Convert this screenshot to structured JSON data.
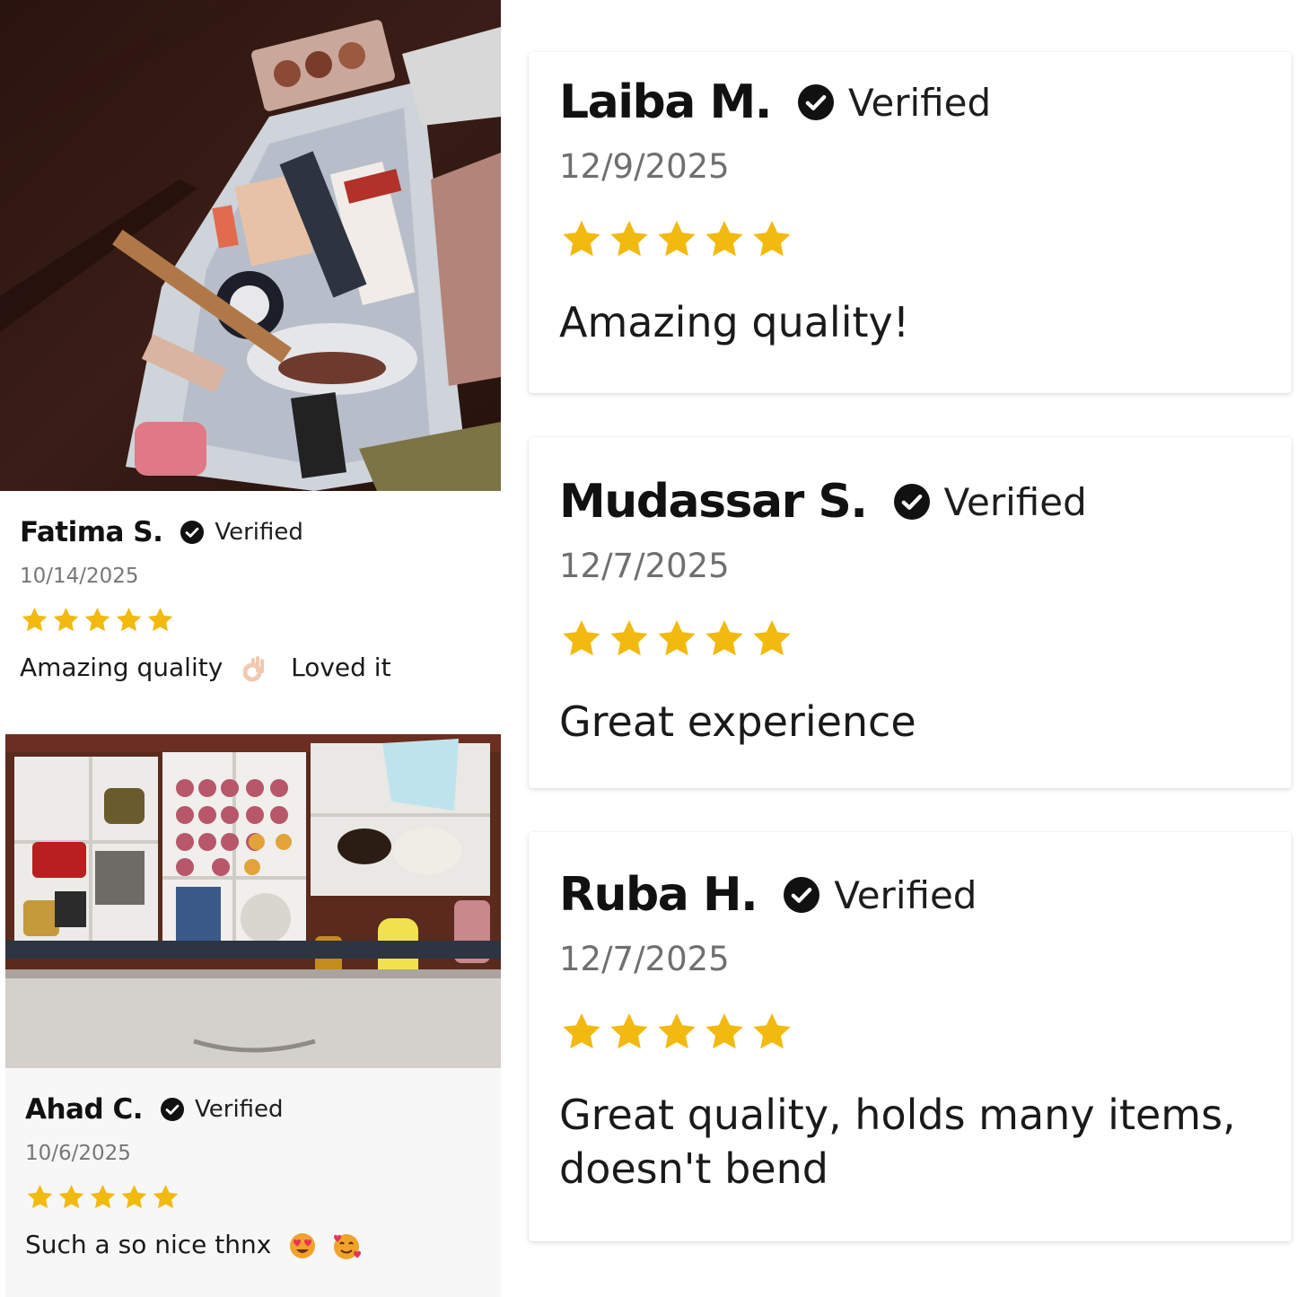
{
  "reviews_left": [
    {
      "name": "Fatima S.",
      "verified_label": "Verified",
      "date": "10/14/2025",
      "rating": 5,
      "text_part1": "Amazing quality",
      "emoji1": "ok-hand-emoji",
      "text_part2": "Loved it"
    },
    {
      "name": "Ahad C.",
      "verified_label": "Verified",
      "date": "10/6/2025",
      "rating": 5,
      "text": "Such a so nice thnx",
      "emoji1": "heart-eyes-emoji",
      "emoji2": "smiling-face-with-hearts-emoji"
    }
  ],
  "reviews_right": [
    {
      "name": "Laiba M.",
      "verified_label": "Verified",
      "date": "12/9/2025",
      "rating": 5,
      "text": "Amazing quality!"
    },
    {
      "name": "Mudassar S.",
      "verified_label": "Verified",
      "date": "12/7/2025",
      "rating": 5,
      "text": "Great experience"
    },
    {
      "name": "Ruba H.",
      "verified_label": "Verified",
      "date": "12/7/2025",
      "rating": 5,
      "text": "Great quality, holds many items, doesn't bend"
    }
  ],
  "colors": {
    "star": "#f2b90f",
    "check_bg": "#111111",
    "date": "#777777"
  }
}
